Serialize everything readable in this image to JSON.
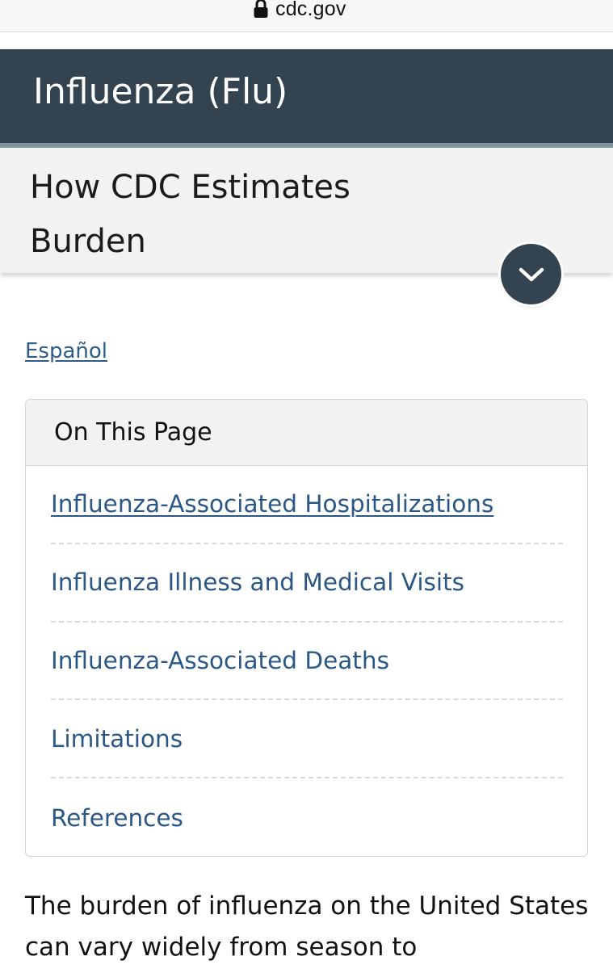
{
  "browser": {
    "url": "cdc.gov",
    "lock_icon": "lock-icon"
  },
  "header": {
    "site_title": "Influenza (Flu)",
    "background_color": "#33434f",
    "accent_color": "#7d939e"
  },
  "subheader": {
    "page_title": "How CDC Estimates Burden",
    "expand_icon": "chevron-down-icon"
  },
  "language_link": "Español",
  "on_this_page": {
    "title": "On This Page",
    "items": [
      {
        "label": "Influenza-Associated Hospitalizations"
      },
      {
        "label": "Influenza Illness and Medical Visits"
      },
      {
        "label": "Influenza-Associated Deaths"
      },
      {
        "label": "Limitations"
      },
      {
        "label": "References"
      }
    ],
    "link_color": "#2a5786"
  },
  "body": {
    "intro": "The burden of influenza on the United States can vary widely from season to"
  }
}
